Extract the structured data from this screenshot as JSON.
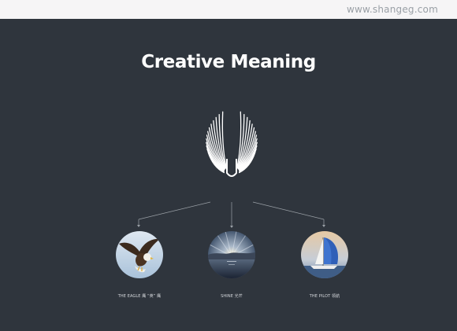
{
  "header": {
    "watermark": "www.shangeg.com"
  },
  "main": {
    "title": "Creative Meaning",
    "items": [
      {
        "label": "THE EAGLE 鹰 “英” 鹰",
        "icon": "eagle-photo"
      },
      {
        "label": "SHINE 光芒",
        "icon": "sunburst-photo"
      },
      {
        "label": "THE PILOT 领航",
        "icon": "sailboat-photo"
      }
    ]
  },
  "colors": {
    "background": "#2f353d",
    "topbar": "#f6f5f6",
    "title": "#ffffff",
    "line": "#9aa0a6"
  }
}
